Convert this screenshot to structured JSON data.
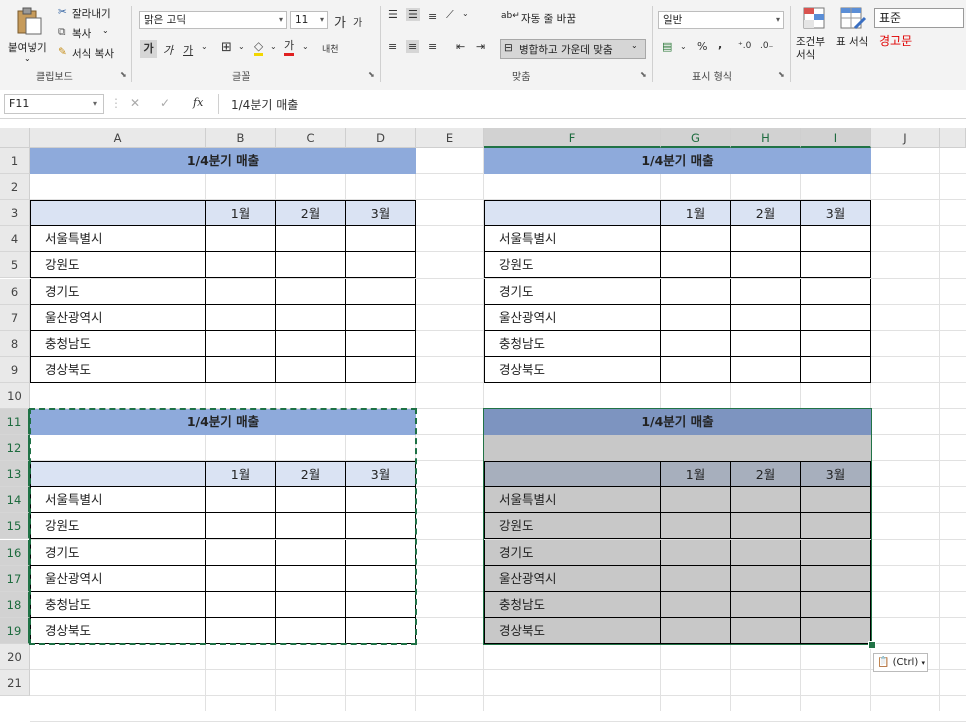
{
  "ribbon": {
    "clipboard": {
      "paste": "붙여넣기",
      "cut": "잘라내기",
      "copy": "복사",
      "format_painter": "서식 복사",
      "group": "클립보드"
    },
    "font": {
      "name": "맑은 고딕",
      "size": "11",
      "grow": "가",
      "shrink": "가",
      "bold": "가",
      "italic": "가",
      "underline": "가",
      "font_color": "가",
      "phonetic": "내천",
      "group": "글꼴"
    },
    "alignment": {
      "wrap": "자동 줄 바꿈",
      "merge": "병합하고 가운데 맞춤",
      "group": "맞춤"
    },
    "number": {
      "format": "일반",
      "percent": "%",
      "comma": ",",
      "group": "표시 형식"
    },
    "styles": {
      "conditional": "조건부 서식",
      "table": "표 서식",
      "normal": "표준",
      "warning": "경고문"
    }
  },
  "formula_bar": {
    "name_box": "F11",
    "fx": "fx",
    "value": "1/4분기 매출"
  },
  "columns": [
    "A",
    "B",
    "C",
    "D",
    "E",
    "F",
    "G",
    "H",
    "I",
    "J"
  ],
  "rows": [
    "1",
    "2",
    "3",
    "4",
    "5",
    "6",
    "7",
    "8",
    "9",
    "10",
    "11",
    "12",
    "13",
    "14",
    "15",
    "16",
    "17",
    "18",
    "19",
    "20",
    "21"
  ],
  "table": {
    "title": "1/4분기 매출",
    "months": [
      "1월",
      "2월",
      "3월"
    ],
    "regions": [
      "서울특별시",
      "강원도",
      "경기도",
      "울산광역시",
      "충청남도",
      "경상북도"
    ]
  },
  "paste_options": "(Ctrl)",
  "colors": {
    "title_bg": "#8eaadb",
    "header_bg": "#dae3f3",
    "accent": "#217346"
  }
}
